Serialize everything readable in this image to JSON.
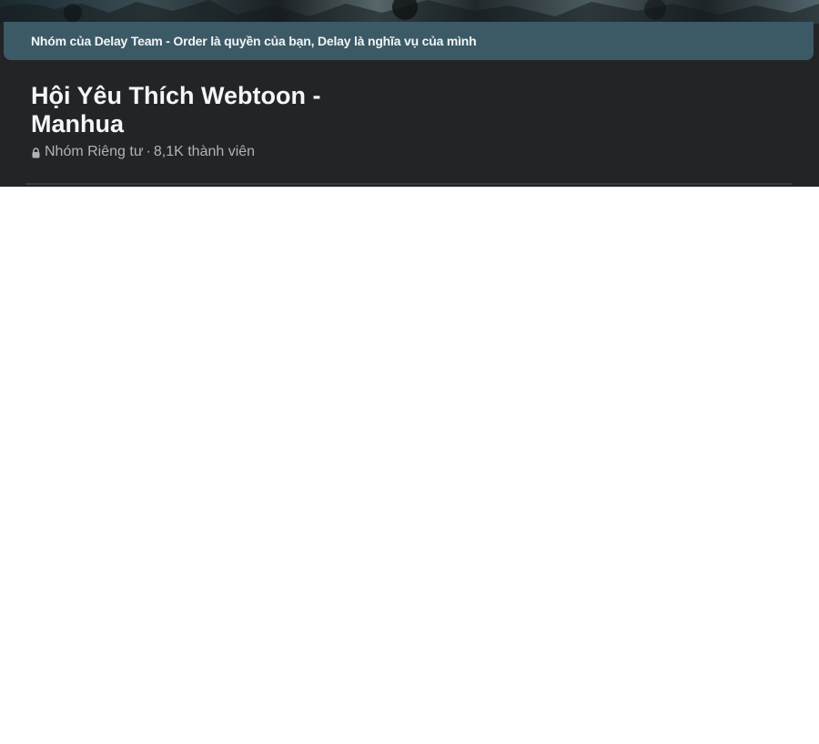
{
  "banner": {
    "text": "Nhóm của Delay Team - Order là quyền của bạn, Delay là nghĩa vụ của mình"
  },
  "group": {
    "name_line1": "Hội Yêu Thích Webtoon -",
    "name_line2": "Manhua",
    "privacy": "Nhóm Riêng tư",
    "separator": "·",
    "members": "8,1K thành viên"
  },
  "icons": {
    "privacy": "lock-icon"
  },
  "colors": {
    "card_background": "#232425",
    "banner_background": "#3c5a66",
    "title_text": "#f5f6f7",
    "meta_text": "#b0b3b8",
    "page_background": "#ffffff"
  }
}
